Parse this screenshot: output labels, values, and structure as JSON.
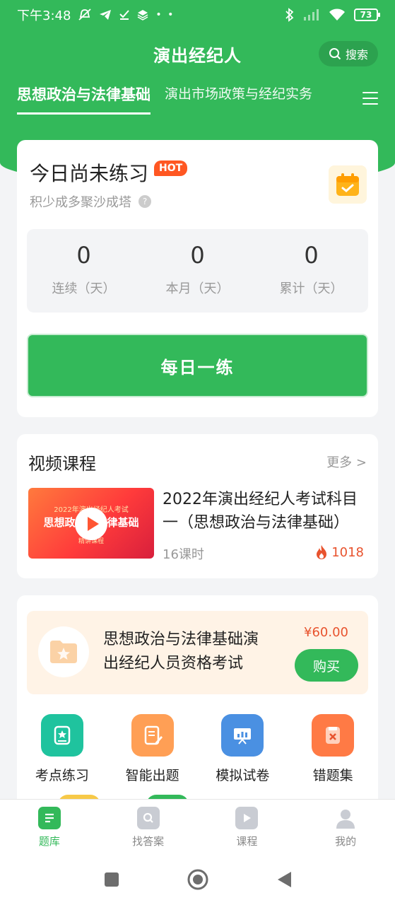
{
  "status_bar": {
    "time": "下午3:48",
    "battery": "73"
  },
  "header": {
    "title": "演出经纪人",
    "search_label": "搜索"
  },
  "tabs": [
    {
      "label": "思想政治与法律基础",
      "active": true
    },
    {
      "label": "演出市场政策与经纪实务",
      "active": false
    }
  ],
  "practice_card": {
    "title": "今日尚未练习",
    "badge": "HOT",
    "subtitle": "积少成多聚沙成塔",
    "help": "?",
    "stats": [
      {
        "value": "0",
        "label": "连续（天）"
      },
      {
        "value": "0",
        "label": "本月（天）"
      },
      {
        "value": "0",
        "label": "累计（天）"
      }
    ],
    "button_label": "每日一练"
  },
  "video_section": {
    "title": "视频课程",
    "more": "更多 >",
    "course": {
      "thumb_line1": "2022年演出经纪人考试",
      "thumb_line2": "思想政治与法律基础",
      "thumb_line3": "精讲课程",
      "title": "2022年演出经纪人考试科目一（思想政治与法律基础）",
      "lessons": "16课时",
      "hot_count": "1018"
    }
  },
  "promo": {
    "title": "思想政治与法律基础演出经纪人员资格考试",
    "price": "¥60.00",
    "buy_label": "购买"
  },
  "features": [
    {
      "label": "考点练习",
      "icon": "star-book-icon",
      "color": "#1fc39e"
    },
    {
      "label": "智能出题",
      "icon": "document-pen-icon",
      "color": "#ff9f55"
    },
    {
      "label": "模拟试卷",
      "icon": "presentation-chart-icon",
      "color": "#4a90e2"
    },
    {
      "label": "错题集",
      "icon": "error-card-icon",
      "color": "#ff7a45"
    }
  ],
  "bottom_nav": [
    {
      "label": "题库",
      "active": true
    },
    {
      "label": "找答案",
      "active": false
    },
    {
      "label": "课程",
      "active": false
    },
    {
      "label": "我的",
      "active": false
    }
  ],
  "colors": {
    "accent": "#33b95a",
    "hot": "#ff5722",
    "price": "#e8532e"
  }
}
